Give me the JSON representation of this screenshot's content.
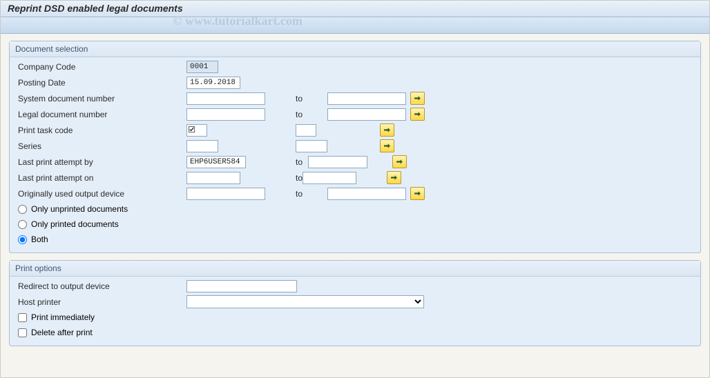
{
  "title": "Reprint DSD enabled legal documents",
  "watermark": "© www.tutorialkart.com",
  "groups": {
    "docsel": {
      "title": "Document selection",
      "company_code_label": "Company Code",
      "company_code_value": "0001",
      "posting_date_label": "Posting Date",
      "posting_date_value": "15.09.2018",
      "sys_docnum_label": "System document number",
      "sys_docnum_from": "",
      "sys_docnum_to": "",
      "legal_docnum_label": "Legal document number",
      "legal_docnum_from": "",
      "legal_docnum_to": "",
      "print_task_label": "Print task code",
      "print_task_from_checked": "true",
      "print_task_to": "",
      "series_label": "Series",
      "series_from": "",
      "series_to": "",
      "last_by_label": "Last print attempt by",
      "last_by_from": "EHP6USER584",
      "last_by_to": "",
      "last_on_label": "Last print attempt on",
      "last_on_from": "",
      "last_on_to": "",
      "output_dev_label": "Originally used output device",
      "output_dev_from": "",
      "output_dev_to": "",
      "to_label": "to",
      "radio_unprinted": "Only unprinted documents",
      "radio_printed": "Only printed documents",
      "radio_both": "Both"
    },
    "printopt": {
      "title": "Print options",
      "redirect_label": "Redirect to output device",
      "redirect_value": "",
      "host_label": "Host printer",
      "host_value": "",
      "print_immed": "Print immediately",
      "delete_after": "Delete after print"
    }
  }
}
